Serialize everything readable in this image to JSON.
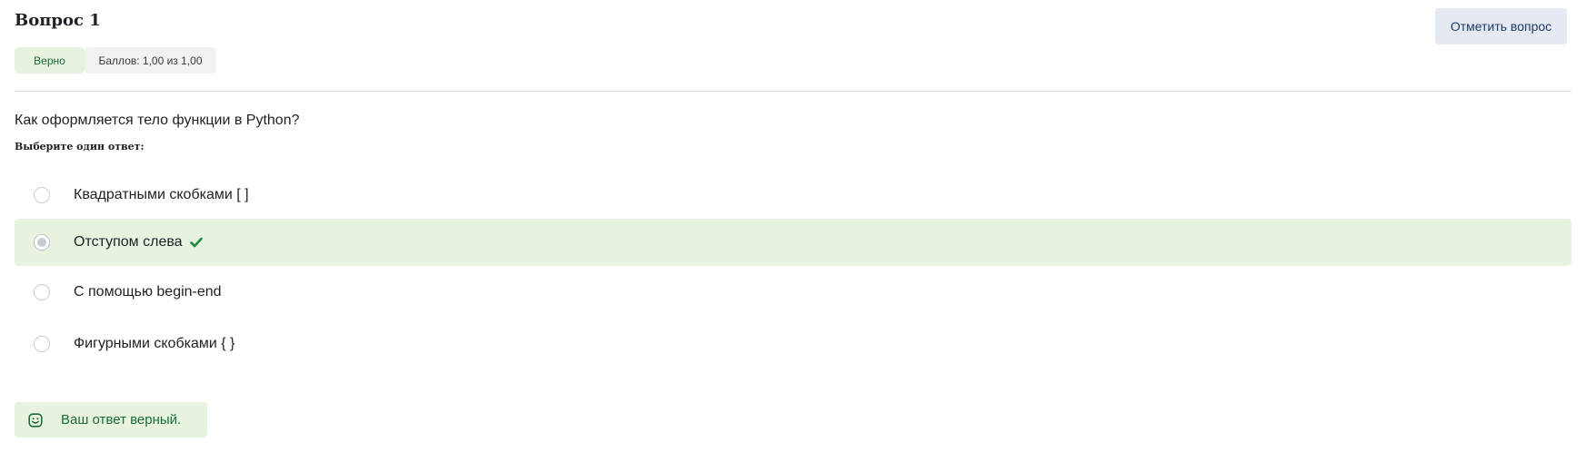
{
  "question": {
    "title": "Вопрос 1",
    "flag_label": "Отметить вопрос",
    "status_badge": "Верно",
    "grade_badge": "Баллов: 1,00 из 1,00",
    "text": "Как оформляется тело функции в Python?",
    "prompt": "Выберите один ответ:"
  },
  "answers": [
    {
      "label": "Квадратными скобками [ ]",
      "selected": false,
      "correct": false
    },
    {
      "label": "Отступом слева",
      "selected": true,
      "correct": true
    },
    {
      "label": "С помощью begin-end",
      "selected": false,
      "correct": false
    },
    {
      "label": "Фигурными скобками { }",
      "selected": false,
      "correct": false
    }
  ],
  "feedback": {
    "text": "Ваш ответ верный.",
    "icon": "smiley-icon"
  },
  "colors": {
    "correct_bg": "#e7f3df",
    "correct_text": "#1d6b3c",
    "flag_bg": "#e4e9f2",
    "check_green": "#1e8e3e"
  }
}
